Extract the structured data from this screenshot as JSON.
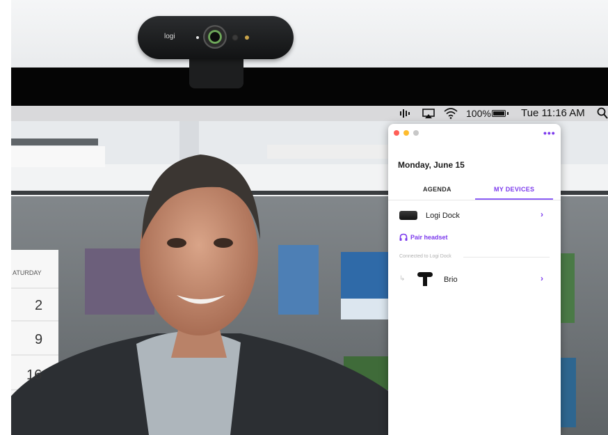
{
  "webcam": {
    "logo": "logi"
  },
  "menubar": {
    "battery_percent": "100%",
    "time": "Tue 11:16 AM"
  },
  "background": {
    "calendar": {
      "day": "ATURDAY",
      "dates": [
        "2",
        "9",
        "16"
      ]
    }
  },
  "popup": {
    "date": "Monday, June 15",
    "tabs": [
      {
        "label": "AGENDA",
        "active": false
      },
      {
        "label": "MY DEVICES",
        "active": true
      }
    ],
    "devices": [
      {
        "label": "Logi Dock",
        "icon": "dock-icon"
      }
    ],
    "pair_headset": "Pair headset",
    "connected_to": "Connected to Logi Dock",
    "sub_devices": [
      {
        "label": "Brio",
        "icon": "webcam-icon"
      }
    ],
    "colors": {
      "accent": "#7c3aed",
      "traffic": [
        "#ff5f57",
        "#febc2e",
        "#c8c8c8"
      ]
    }
  }
}
